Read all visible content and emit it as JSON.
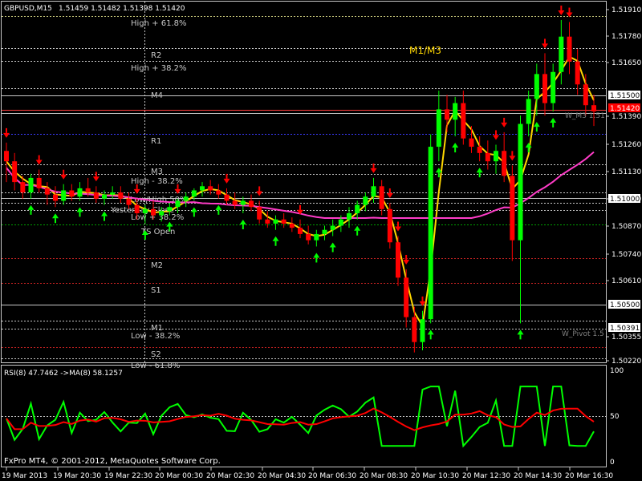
{
  "header": {
    "symbol_tf": "GBPUSD,M15",
    "ohlc": "1.51459 1.51482 1.51398 1.51420"
  },
  "indicator_label": "M1/M3",
  "price_axis": [
    "1.51910",
    "1.51780",
    "1.51650",
    "1.51500",
    "1.51390",
    "1.51260",
    "1.51130",
    "1.51000",
    "1.50870",
    "1.50740",
    "1.50610",
    "1.50500",
    "1.50391",
    "1.50355",
    "1.50220"
  ],
  "price_tags": {
    "current": "1.51420",
    "line_upper": "1.51500",
    "line_lower": "1.50500",
    "pivot": "1.50391",
    "line_mid": "1.51000"
  },
  "levels": [
    {
      "label": "High + 61.8%",
      "color": "#c8c8c8"
    },
    {
      "label": "R2",
      "color": "#c8c8c8"
    },
    {
      "label": "High + 38.2%",
      "color": "#c8c8c8"
    },
    {
      "label": "M4",
      "color": "#c8c8c8"
    },
    {
      "label": "R1",
      "color": "#c8c8c8"
    },
    {
      "label": "M3",
      "color": "#c8c8c8"
    },
    {
      "label": "High - 38.2%",
      "color": "#c8c8c8"
    },
    {
      "label": "Low/High 50%",
      "color": "#c8c8c8"
    },
    {
      "label": "Yesterday Close",
      "color": "#c8c8c8"
    },
    {
      "label": "Low + 38.2%",
      "color": "#c8c8c8"
    },
    {
      "label": "TS Open",
      "color": "#c8c8c8"
    },
    {
      "label": "M2",
      "color": "#c8c8c8"
    },
    {
      "label": "S1",
      "color": "#c8c8c8"
    },
    {
      "label": "M1",
      "color": "#c8c8c8"
    },
    {
      "label": "Low - 38.2%",
      "color": "#c8c8c8"
    },
    {
      "label": "S2",
      "color": "#c8c8c8"
    },
    {
      "label": "Low - 61.8%",
      "color": "#c8c8c8"
    }
  ],
  "right_labels": {
    "w_m3": "W_M3 1.51",
    "w_pivot": "W_Pivot 1.5"
  },
  "rsi": {
    "title": "RSI(8) 47.7462 ->MA(8) 58.1257",
    "axis": [
      "100",
      "50",
      "0"
    ]
  },
  "copyright": "FxPro MT4, © 2001-2012, MetaQuotes Software Corp.",
  "time_axis": [
    "19 Mar 2013",
    "19 Mar 20:30",
    "19 Mar 22:30",
    "20 Mar 00:30",
    "20 Mar 02:30",
    "20 Mar 04:30",
    "20 Mar 06:30",
    "20 Mar 08:30",
    "20 Mar 10:30",
    "20 Mar 12:30",
    "20 Mar 14:30",
    "20 Mar 16:30"
  ],
  "colors": {
    "bull": "#00ff00",
    "bear": "#ff0000",
    "ma_yellow": "#ffd700",
    "ma_magenta": "#ff3cc8",
    "grid": "#c8c8c8"
  },
  "chart_data": {
    "type": "candlestick",
    "price_range": [
      1.5022,
      1.5191
    ],
    "ohlc": [
      [
        1.5123,
        1.5127,
        1.5108,
        1.5118
      ],
      [
        1.5118,
        1.5122,
        1.5104,
        1.5108
      ],
      [
        1.5108,
        1.5111,
        1.51,
        1.5103
      ],
      [
        1.5103,
        1.5112,
        1.51,
        1.511
      ],
      [
        1.511,
        1.5114,
        1.5103,
        1.5105
      ],
      [
        1.5105,
        1.5108,
        1.5097,
        1.5102
      ],
      [
        1.5102,
        1.5106,
        1.5096,
        1.5099
      ],
      [
        1.5099,
        1.5107,
        1.5097,
        1.5104
      ],
      [
        1.5104,
        1.5107,
        1.5099,
        1.5101
      ],
      [
        1.5101,
        1.5108,
        1.5099,
        1.5105
      ],
      [
        1.5105,
        1.511,
        1.5101,
        1.5103
      ],
      [
        1.5103,
        1.5106,
        1.5098,
        1.51
      ],
      [
        1.51,
        1.5104,
        1.5097,
        1.5102
      ],
      [
        1.5102,
        1.5106,
        1.51,
        1.5103
      ],
      [
        1.5103,
        1.5106,
        1.5098,
        1.51
      ],
      [
        1.51,
        1.5103,
        1.5095,
        1.5097
      ],
      [
        1.5097,
        1.51,
        1.509,
        1.5093
      ],
      [
        1.5093,
        1.5097,
        1.5088,
        1.5095
      ],
      [
        1.5095,
        1.5099,
        1.509,
        1.5092
      ],
      [
        1.5092,
        1.5096,
        1.5089,
        1.5094
      ],
      [
        1.5094,
        1.5098,
        1.5092,
        1.5096
      ],
      [
        1.5096,
        1.51,
        1.5093,
        1.5099
      ],
      [
        1.5099,
        1.5103,
        1.5096,
        1.5101
      ],
      [
        1.5101,
        1.5105,
        1.5099,
        1.5104
      ],
      [
        1.5104,
        1.5108,
        1.5101,
        1.5106
      ],
      [
        1.5106,
        1.5109,
        1.5102,
        1.5104
      ],
      [
        1.5104,
        1.5107,
        1.51,
        1.5102
      ],
      [
        1.5102,
        1.5105,
        1.5097,
        1.5099
      ],
      [
        1.5099,
        1.5103,
        1.5095,
        1.5097
      ],
      [
        1.5097,
        1.5101,
        1.5093,
        1.5099
      ],
      [
        1.5099,
        1.5102,
        1.5094,
        1.5096
      ],
      [
        1.5096,
        1.5099,
        1.5088,
        1.509
      ],
      [
        1.509,
        1.5094,
        1.5086,
        1.5088
      ],
      [
        1.5088,
        1.5092,
        1.5085,
        1.509
      ],
      [
        1.509,
        1.5093,
        1.5086,
        1.5088
      ],
      [
        1.5088,
        1.5091,
        1.5084,
        1.5086
      ],
      [
        1.5086,
        1.509,
        1.5081,
        1.5083
      ],
      [
        1.5083,
        1.5087,
        1.5078,
        1.508
      ],
      [
        1.508,
        1.5085,
        1.5077,
        1.5083
      ],
      [
        1.5083,
        1.5087,
        1.508,
        1.5085
      ],
      [
        1.5085,
        1.509,
        1.5082,
        1.5087
      ],
      [
        1.5087,
        1.5092,
        1.5084,
        1.509
      ],
      [
        1.509,
        1.5096,
        1.5086,
        1.5093
      ],
      [
        1.5093,
        1.5099,
        1.509,
        1.5097
      ],
      [
        1.5097,
        1.5103,
        1.5094,
        1.5101
      ],
      [
        1.5101,
        1.511,
        1.5098,
        1.5106
      ],
      [
        1.5106,
        1.5109,
        1.5092,
        1.5095
      ],
      [
        1.5095,
        1.5098,
        1.5076,
        1.5079
      ],
      [
        1.5079,
        1.5082,
        1.5058,
        1.5062
      ],
      [
        1.5062,
        1.5066,
        1.5038,
        1.5043
      ],
      [
        1.5043,
        1.5048,
        1.5026,
        1.5031
      ],
      [
        1.5031,
        1.5046,
        1.5027,
        1.5042
      ],
      [
        1.5042,
        1.5131,
        1.504,
        1.5125
      ],
      [
        1.5125,
        1.5152,
        1.5118,
        1.5143
      ],
      [
        1.5143,
        1.515,
        1.5132,
        1.5138
      ],
      [
        1.5138,
        1.5149,
        1.513,
        1.5146
      ],
      [
        1.5146,
        1.5152,
        1.5126,
        1.5129
      ],
      [
        1.5129,
        1.5135,
        1.5122,
        1.5125
      ],
      [
        1.5125,
        1.513,
        1.5118,
        1.5122
      ],
      [
        1.5122,
        1.5128,
        1.5114,
        1.5118
      ],
      [
        1.5118,
        1.5126,
        1.5112,
        1.5123
      ],
      [
        1.5123,
        1.5132,
        1.5108,
        1.5111
      ],
      [
        1.5111,
        1.5116,
        1.507,
        1.508
      ],
      [
        1.508,
        1.514,
        1.504,
        1.5136
      ],
      [
        1.5136,
        1.5152,
        1.513,
        1.5148
      ],
      [
        1.5148,
        1.5165,
        1.514,
        1.516
      ],
      [
        1.516,
        1.517,
        1.514,
        1.5146
      ],
      [
        1.5146,
        1.5165,
        1.5142,
        1.5161
      ],
      [
        1.5161,
        1.5186,
        1.5155,
        1.5178
      ],
      [
        1.5178,
        1.5185,
        1.516,
        1.5166
      ],
      [
        1.5166,
        1.5172,
        1.515,
        1.5155
      ],
      [
        1.5155,
        1.516,
        1.514,
        1.5145
      ],
      [
        1.5145,
        1.515,
        1.5135,
        1.5142
      ]
    ]
  }
}
